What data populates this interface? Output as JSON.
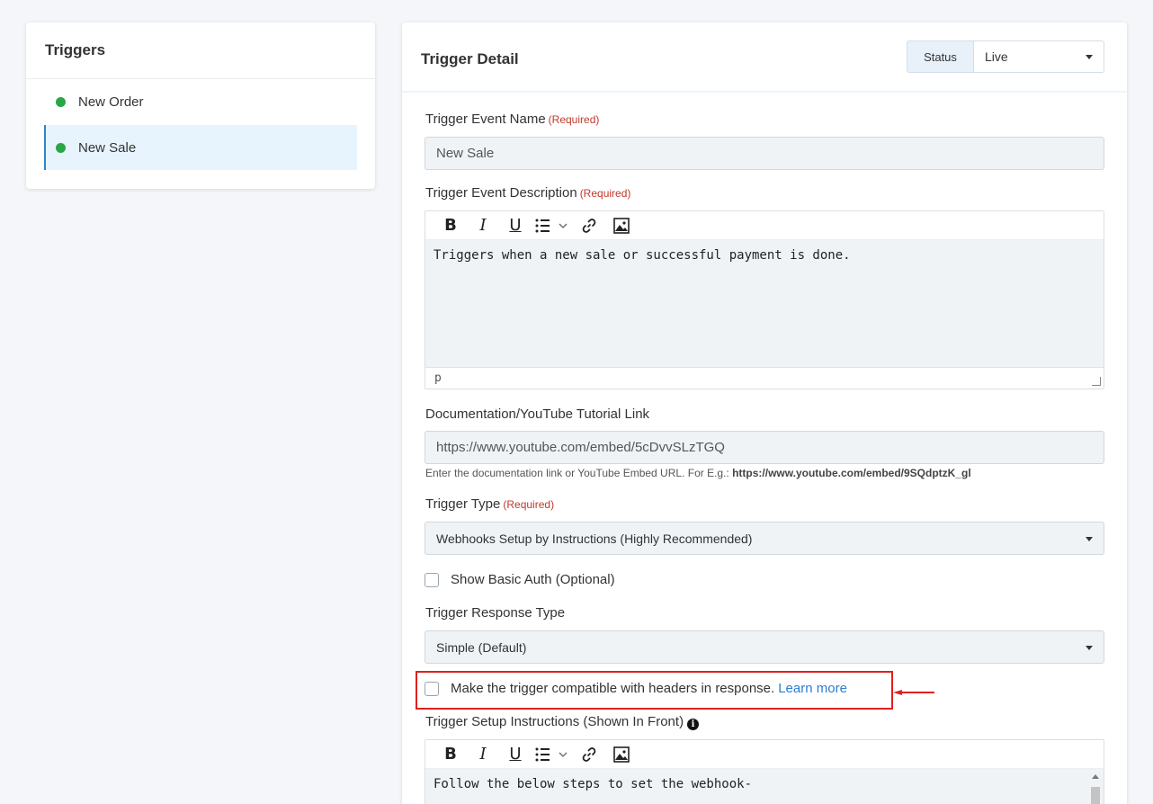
{
  "sidebar": {
    "title": "Triggers",
    "items": [
      {
        "label": "New Order"
      },
      {
        "label": "New Sale"
      }
    ]
  },
  "detail": {
    "title": "Trigger Detail",
    "status_label": "Status",
    "status_value": "Live",
    "required_text": "(Required)",
    "event_name_label": "Trigger Event Name",
    "event_name_value": "New Sale",
    "event_desc_label": "Trigger Event Description",
    "event_desc_text": "Triggers when a new sale or successful payment is done.",
    "editor_path": "p",
    "doc_label": "Documentation/YouTube Tutorial Link",
    "doc_value": "https://www.youtube.com/embed/5cDvvSLzTGQ",
    "doc_help_prefix": "Enter the documentation link or YouTube Embed URL. For E.g.:",
    "doc_help_example": "https://www.youtube.com/embed/9SQdptzK_gl",
    "trigger_type_label": "Trigger Type",
    "trigger_type_value": "Webhooks Setup by Instructions (Highly Recommended)",
    "basic_auth_label": "Show Basic Auth (Optional)",
    "response_type_label": "Trigger Response Type",
    "response_type_value": "Simple (Default)",
    "headers_compat_label": "Make the trigger compatible with headers in response.",
    "learn_more": "Learn more",
    "setup_label": "Trigger Setup Instructions (Shown In Front)",
    "setup_text": "Follow the below steps to set the webhook-"
  },
  "colors": {
    "accent": "#2c86c8",
    "live_dot": "#28a745",
    "required": "#c0392b",
    "highlight": "#e0201e"
  }
}
